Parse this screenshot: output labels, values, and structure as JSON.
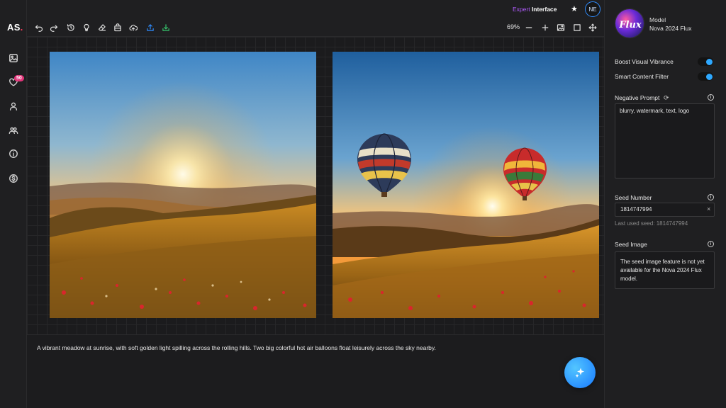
{
  "app": {
    "logo": "AS",
    "logo_dot": "."
  },
  "header": {
    "mode_a": "Expert",
    "mode_b": " Interface",
    "avatar": "NE",
    "zoom": "69%"
  },
  "sidebar": {
    "badge": "50",
    "items": [
      {
        "name": "gallery-icon"
      },
      {
        "name": "favorites-icon"
      },
      {
        "name": "user-icon"
      },
      {
        "name": "community-icon"
      },
      {
        "name": "info-icon"
      },
      {
        "name": "pricing-icon"
      }
    ]
  },
  "prompt": {
    "text": "A vibrant meadow at sunrise, with soft golden light spilling across the rolling hills. Two big colorful hot air balloons float leisurely across the sky nearby."
  },
  "panel": {
    "model_label": "Model",
    "model_name": "Nova 2024 Flux",
    "model_logo_text": "Flux",
    "boost_label": "Boost Visual Vibrance",
    "boost_on": true,
    "filter_label": "Smart Content Filter",
    "filter_on": true,
    "negative_label": "Negative Prompt",
    "negative_value": "blurry, watermark, text, logo",
    "seed_label": "Seed Number",
    "seed_value": "1814747994",
    "last_seed": "Last used seed: 1814747994",
    "seed_image_label": "Seed Image",
    "seed_image_note": "The seed image feature is not yet available for the Nova 2024 Flux model."
  },
  "colors": {
    "accent": "#2ea8ff",
    "badge": "#e2357a",
    "expert": "#b15cff",
    "upload": "#2f8cff",
    "download": "#36c26b"
  }
}
